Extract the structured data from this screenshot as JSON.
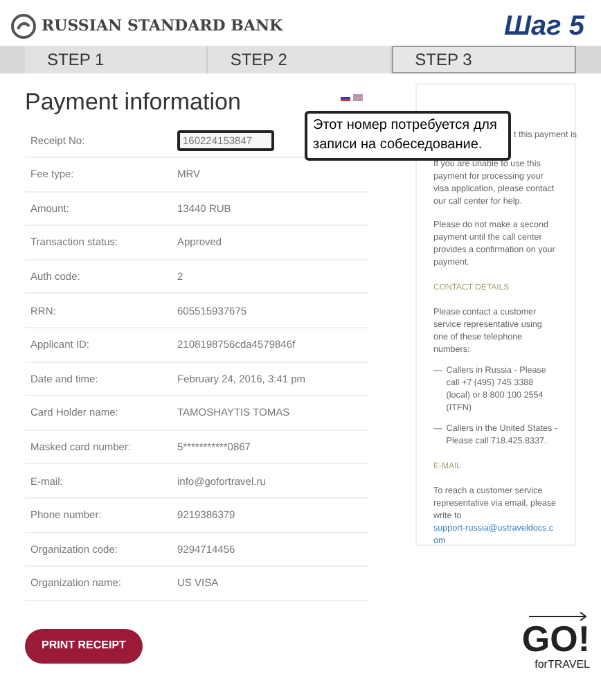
{
  "header": {
    "bank_name": "RUSSIAN STANDARD BANK",
    "step_title": "Шаг 5"
  },
  "tabs": [
    {
      "label": "STEP 1",
      "selected": false
    },
    {
      "label": "STEP 2",
      "selected": false
    },
    {
      "label": "STEP 3",
      "selected": true
    }
  ],
  "page_title": "Payment information",
  "rows": [
    {
      "label": "Receipt No:",
      "value": "160224153847",
      "highlighted": true
    },
    {
      "label": "Fee type:",
      "value": "MRV",
      "highlighted": false
    },
    {
      "label": "Amount:",
      "value": "13440 RUB",
      "highlighted": false
    },
    {
      "label": "Transaction status:",
      "value": "Approved",
      "highlighted": false
    },
    {
      "label": "Auth code:",
      "value": "2",
      "highlighted": false
    },
    {
      "label": "RRN:",
      "value": "605515937675",
      "highlighted": false
    },
    {
      "label": "Applicant ID:",
      "value": "2108198756cda4579846f",
      "highlighted": false
    },
    {
      "label": "Date and time:",
      "value": "February 24, 2016, 3:41 pm",
      "highlighted": false
    },
    {
      "label": "Card Holder name:",
      "value": "TAMOSHAYTIS TOMAS",
      "highlighted": false
    },
    {
      "label": "Masked card number:",
      "value": "5***********0867",
      "highlighted": false
    },
    {
      "label": "E-mail:",
      "value": "info@gofortravel.ru",
      "highlighted": false
    },
    {
      "label": "Phone number:",
      "value": "9219386379",
      "highlighted": false
    },
    {
      "label": "Organization code:",
      "value": "9294714456",
      "highlighted": false
    },
    {
      "label": "Organization name:",
      "value": "US VISA",
      "highlighted": false
    }
  ],
  "callout": "Этот номер потребуется для записи на собеседование.",
  "sidebar": {
    "paragraphs": [
      "t this payment is",
      "If you are unable to use this payment for processing your visa application, please contact our call center for help.",
      "Please do not make a second payment until the call center provides a confirmation on your payment."
    ],
    "contact_heading": "CONTACT DETAILS",
    "contact_intro": "Please contact a customer service representative using one of these telephone numbers:",
    "callers": [
      {
        "dash": "—",
        "text": "Callers in Russia - Please call +7 (495) 745 3388 (local) or 8 800 100 2554 (ITFN)"
      },
      {
        "dash": "—",
        "text": "Callers in the United States - Please call 718.425.8337."
      }
    ],
    "email_heading": "E-MAIL",
    "email_text": "To reach a customer service representative via email, please write to",
    "email_link": "support-russia@ustraveldocs.com"
  },
  "print_button": "PRINT RECEIPT",
  "logo": {
    "mark": "GO!",
    "sub": "forTRAVEL"
  }
}
